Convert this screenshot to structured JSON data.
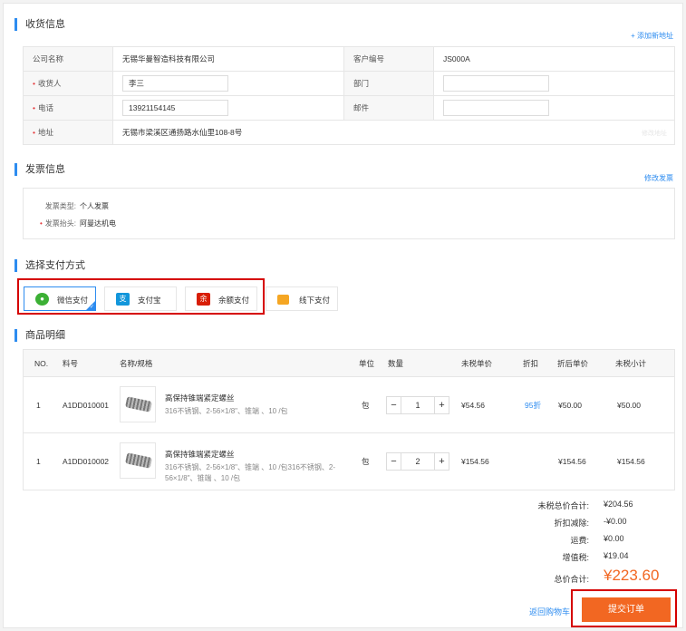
{
  "consignee": {
    "title": "收货信息",
    "add_link": "+ 添加新地址",
    "rows": [
      {
        "label": "公司名称",
        "value": "无锡华曼智造科技有限公司",
        "label2": "客户编号",
        "value2": "JS000A"
      },
      {
        "label": "收货人",
        "value": "李三",
        "label2": "部门",
        "value2": ""
      },
      {
        "label": "电话",
        "value": "13921154145",
        "label2": "邮件",
        "value2": ""
      },
      {
        "label": "地址",
        "value": "无锡市梁溪区通扬路水仙里108-8号",
        "extra": "修改地址"
      }
    ]
  },
  "invoice": {
    "title": "发票信息",
    "edit_link": "修改发票",
    "type_label": "发票类型:",
    "type_value": "个人发票",
    "header_label": "发票抬头:",
    "header_value": "阿曼达机电"
  },
  "payment": {
    "title": "选择支付方式",
    "methods": [
      {
        "label": "微信支付",
        "icon": "wechat-icon",
        "color": "#3cb035",
        "glyph": "●"
      },
      {
        "label": "支付宝",
        "icon": "alipay-icon",
        "color": "#1296db",
        "glyph": "支"
      },
      {
        "label": "余额支付",
        "icon": "balance-icon",
        "color": "#d81e06",
        "glyph": "余"
      },
      {
        "label": "线下支付",
        "icon": "offline-icon",
        "color": "#f5a623",
        "glyph": "▮"
      }
    ]
  },
  "products": {
    "title": "商品明细",
    "headers": [
      "NO.",
      "料号",
      "名称/规格",
      "单位",
      "数量",
      "未税单价",
      "折扣",
      "折后单价",
      "未税小计"
    ],
    "items": [
      {
        "no": "1",
        "sku": "A1DD010001",
        "name": "高保持锥端紧定螺丝",
        "spec": "316不锈钢、2-56×1/8\"、锥端 、10 /包",
        "unit": "包",
        "qty": "1",
        "price": "¥54.56",
        "discount": "95折",
        "disc_price": "¥50.00",
        "subtotal": "¥50.00"
      },
      {
        "no": "1",
        "sku": "A1DD010002",
        "name": "高保持锥端紧定螺丝",
        "spec": "316不锈钢、2-56×1/8\"、锥端 、10 /包316不锈钢、2-56×1/8\"、锥端 、10 /包",
        "unit": "包",
        "qty": "2",
        "price": "¥154.56",
        "discount": "",
        "disc_price": "¥154.56",
        "subtotal": "¥154.56"
      }
    ]
  },
  "summary": {
    "pretax_label": "未税总价合计:",
    "pretax_value": "¥204.56",
    "discount_label": "折扣减除:",
    "discount_value": "-¥0.00",
    "shipping_label": "运费:",
    "shipping_value": "¥0.00",
    "vat_label": "增值税:",
    "vat_value": "¥19.04",
    "total_label": "总价合计:",
    "total_value": "¥223.60",
    "back_link": "返回购物车",
    "submit_label": "提交订单"
  }
}
